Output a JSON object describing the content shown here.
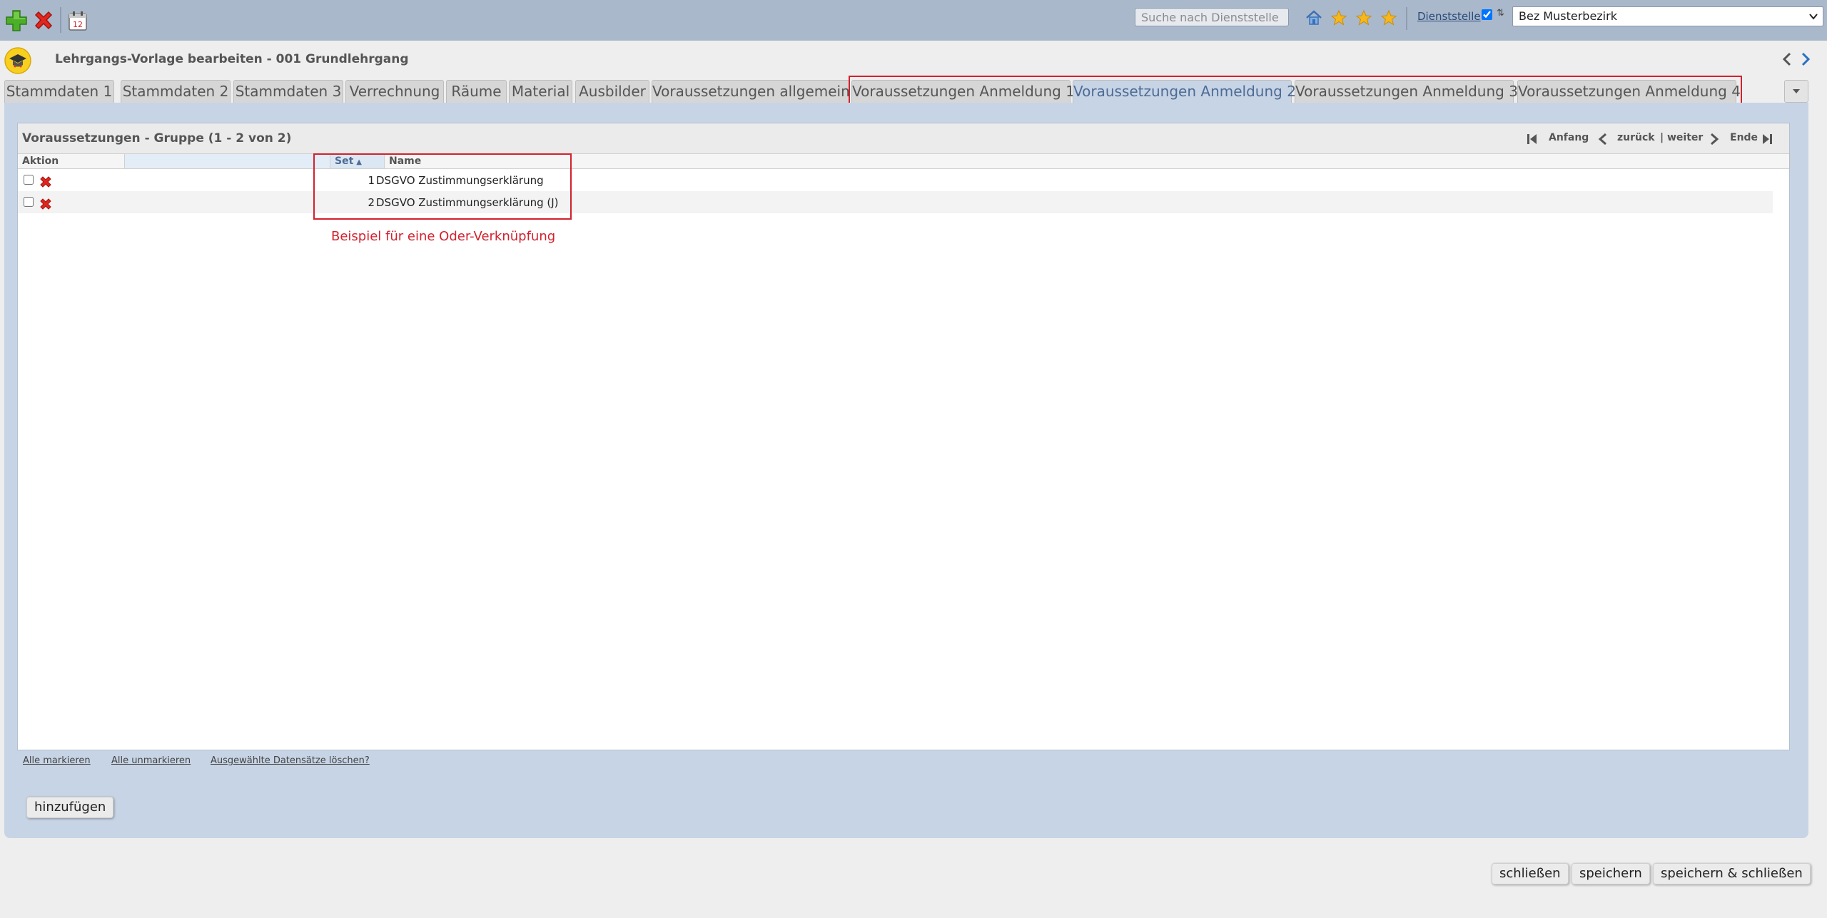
{
  "toolbar": {
    "search_placeholder": "Suche nach Dienststelle",
    "dienststelle_label": "Dienststelle",
    "dienststelle_checked": true,
    "dienststelle_value": "Bez Musterbezirk",
    "calendar_day": "12",
    "icons": [
      "plus-icon",
      "delete-icon",
      "calendar-icon",
      "home-icon",
      "star-icon",
      "star-icon",
      "star-icon",
      "sort-updown-icon",
      "chevron-down-icon"
    ]
  },
  "header": {
    "title": "Lehrgangs-Vorlage bearbeiten - 001 Grundlehrgang"
  },
  "tabs": [
    {
      "label": "Stammdaten 1"
    },
    {
      "label": "Stammdaten 2"
    },
    {
      "label": "Stammdaten 3"
    },
    {
      "label": "Verrechnung"
    },
    {
      "label": "Räume"
    },
    {
      "label": "Material"
    },
    {
      "label": "Ausbilder"
    },
    {
      "label": "Voraussetzungen allgemein"
    },
    {
      "label": "Voraussetzungen Anmeldung 1"
    },
    {
      "label": "Voraussetzungen Anmeldung 2"
    },
    {
      "label": "Voraussetzungen Anmeldung 3"
    },
    {
      "label": "Voraussetzungen Anmeldung 4"
    }
  ],
  "active_tab": "Voraussetzungen Anmeldung 2",
  "grid": {
    "title": "Voraussetzungen - Gruppe (1 - 2 von 2)",
    "pager": {
      "first": "Anfang",
      "prev": "zurück",
      "next": "| weiter",
      "last": "Ende"
    },
    "columns": {
      "action": "Aktion",
      "blank": "",
      "set": "Set",
      "name": "Name"
    },
    "rows": [
      {
        "set": "1",
        "name": "DSGVO Zustimmungserklärung"
      },
      {
        "set": "2",
        "name": "DSGVO Zustimmungserklärung (J)"
      }
    ],
    "annotation": "Beispiel für eine Oder-Verknüpfung",
    "links": {
      "select_all": "Alle markieren",
      "unselect_all": "Alle unmarkieren",
      "delete_selected": "Ausgewählte Datensätze löschen?"
    }
  },
  "buttons": {
    "add": "hinzufügen",
    "close": "schließen",
    "save": "speichern",
    "save_close": "speichern & schließen"
  },
  "colors": {
    "toolbar_bg": "#a9b8cb",
    "panel_bg": "#c7d4e5",
    "highlight": "#d3212d",
    "active_tab_text": "#4e6b95"
  }
}
